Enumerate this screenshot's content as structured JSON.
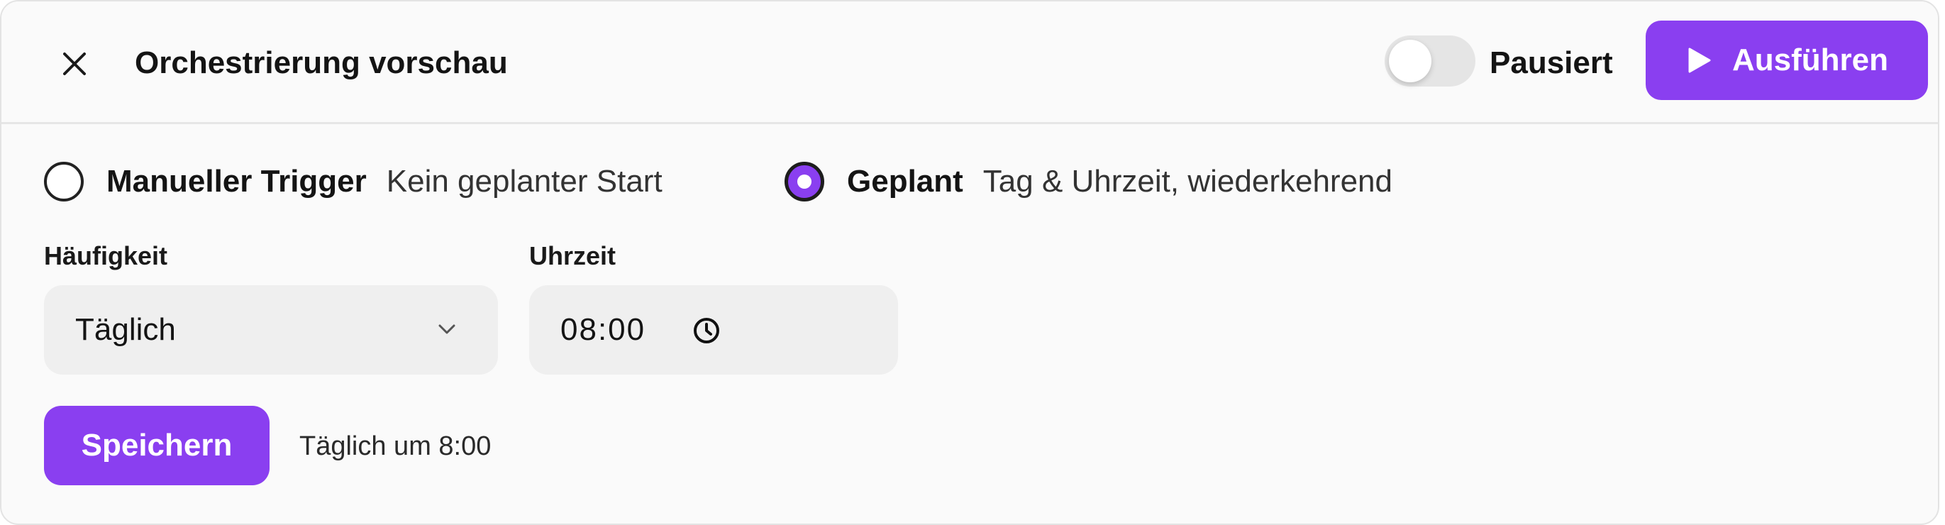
{
  "header": {
    "close_icon": "close-icon",
    "title": "Orchestrierung vorschau",
    "toggle": {
      "label": "Pausiert",
      "on": false
    },
    "run_button": {
      "label": "Ausführen",
      "icon": "play-icon"
    }
  },
  "trigger_options": [
    {
      "label": "Manueller Trigger",
      "description": "Kein geplanter Start",
      "selected": false
    },
    {
      "label": "Geplant",
      "description": "Tag & Uhrzeit, wiederkehrend",
      "selected": true
    }
  ],
  "schedule": {
    "frequency_label": "Häufigkeit",
    "frequency_value": "Täglich",
    "time_label": "Uhrzeit",
    "time_value": "08:00"
  },
  "footer": {
    "save_label": "Speichern",
    "summary": "Täglich um 8:00"
  },
  "colors": {
    "accent": "#8a3ff0",
    "panel_bg": "#fafafa",
    "field_bg": "#efefef",
    "toggle_off": "#e5e5e5"
  }
}
